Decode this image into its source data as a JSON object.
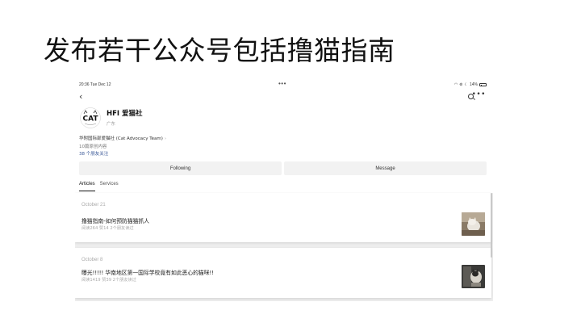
{
  "slide": {
    "title": "发布若干公众号包括撸猫指南"
  },
  "status_bar": {
    "time": "20:36  Tue Dec 12",
    "battery": "14%"
  },
  "profile": {
    "name": "HFI 爱猫社",
    "region": "广东",
    "description": "华附国际部爱猫社 (Cat Advocacy Team)",
    "originals": "10篇原创内容",
    "friends_following": "38 个朋友关注",
    "logo_text": "CAT"
  },
  "actions": {
    "following_label": "Following",
    "message_label": "Message"
  },
  "tabs": [
    {
      "label": "Articles",
      "active": true
    },
    {
      "label": "Services",
      "active": false
    }
  ],
  "articles": [
    {
      "date": "October 21",
      "title": "撸猫指南-如何预防猫猫抓人",
      "meta": "阅读264  赞14  2个朋友读过"
    },
    {
      "date": "October 8",
      "title": "曝光!!!!! 华南地区第一国际学校竟有如此恶心的猫咪!!",
      "meta": "阅读1419  赞39  2个朋友读过"
    }
  ]
}
